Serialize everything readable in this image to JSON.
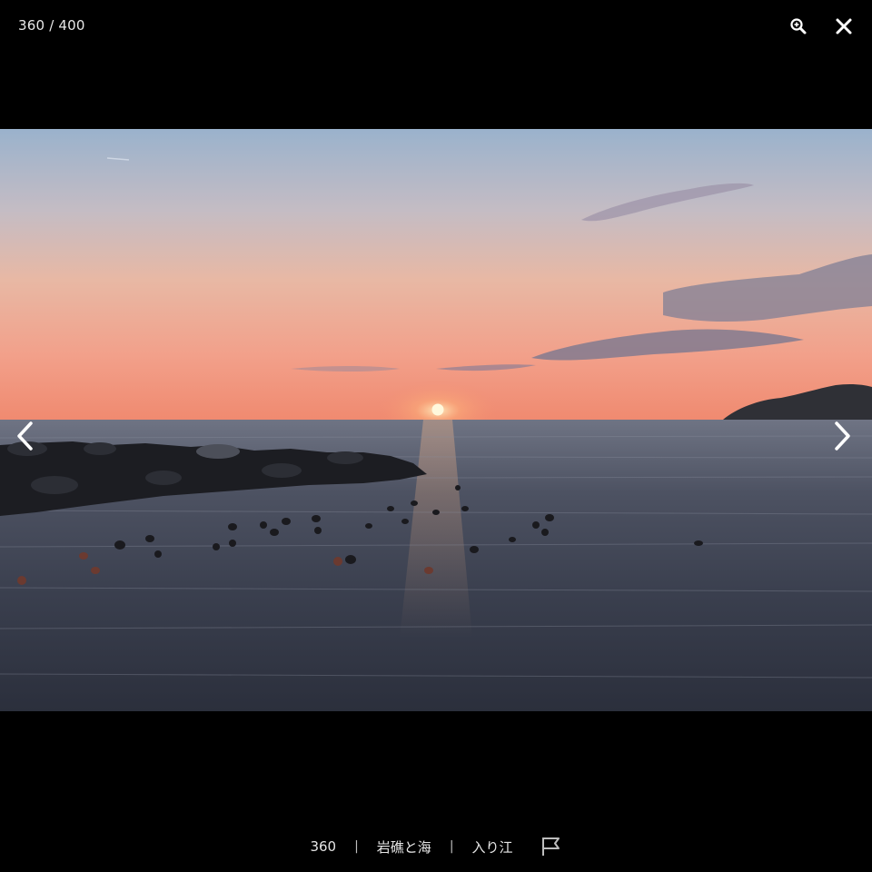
{
  "viewer": {
    "counter": "360 / 400",
    "background_color": "#000000",
    "icon_color": "#ffffff"
  },
  "toolbar": {
    "zoom_icon": "zoom-in-icon",
    "close_icon": "close-icon"
  },
  "navigation": {
    "prev_icon": "chevron-left-icon",
    "next_icon": "chevron-right-icon"
  },
  "caption": {
    "number": "360",
    "separator": "|",
    "title": "岩礁と海",
    "category": "入り江",
    "report_icon": "flag-icon"
  }
}
